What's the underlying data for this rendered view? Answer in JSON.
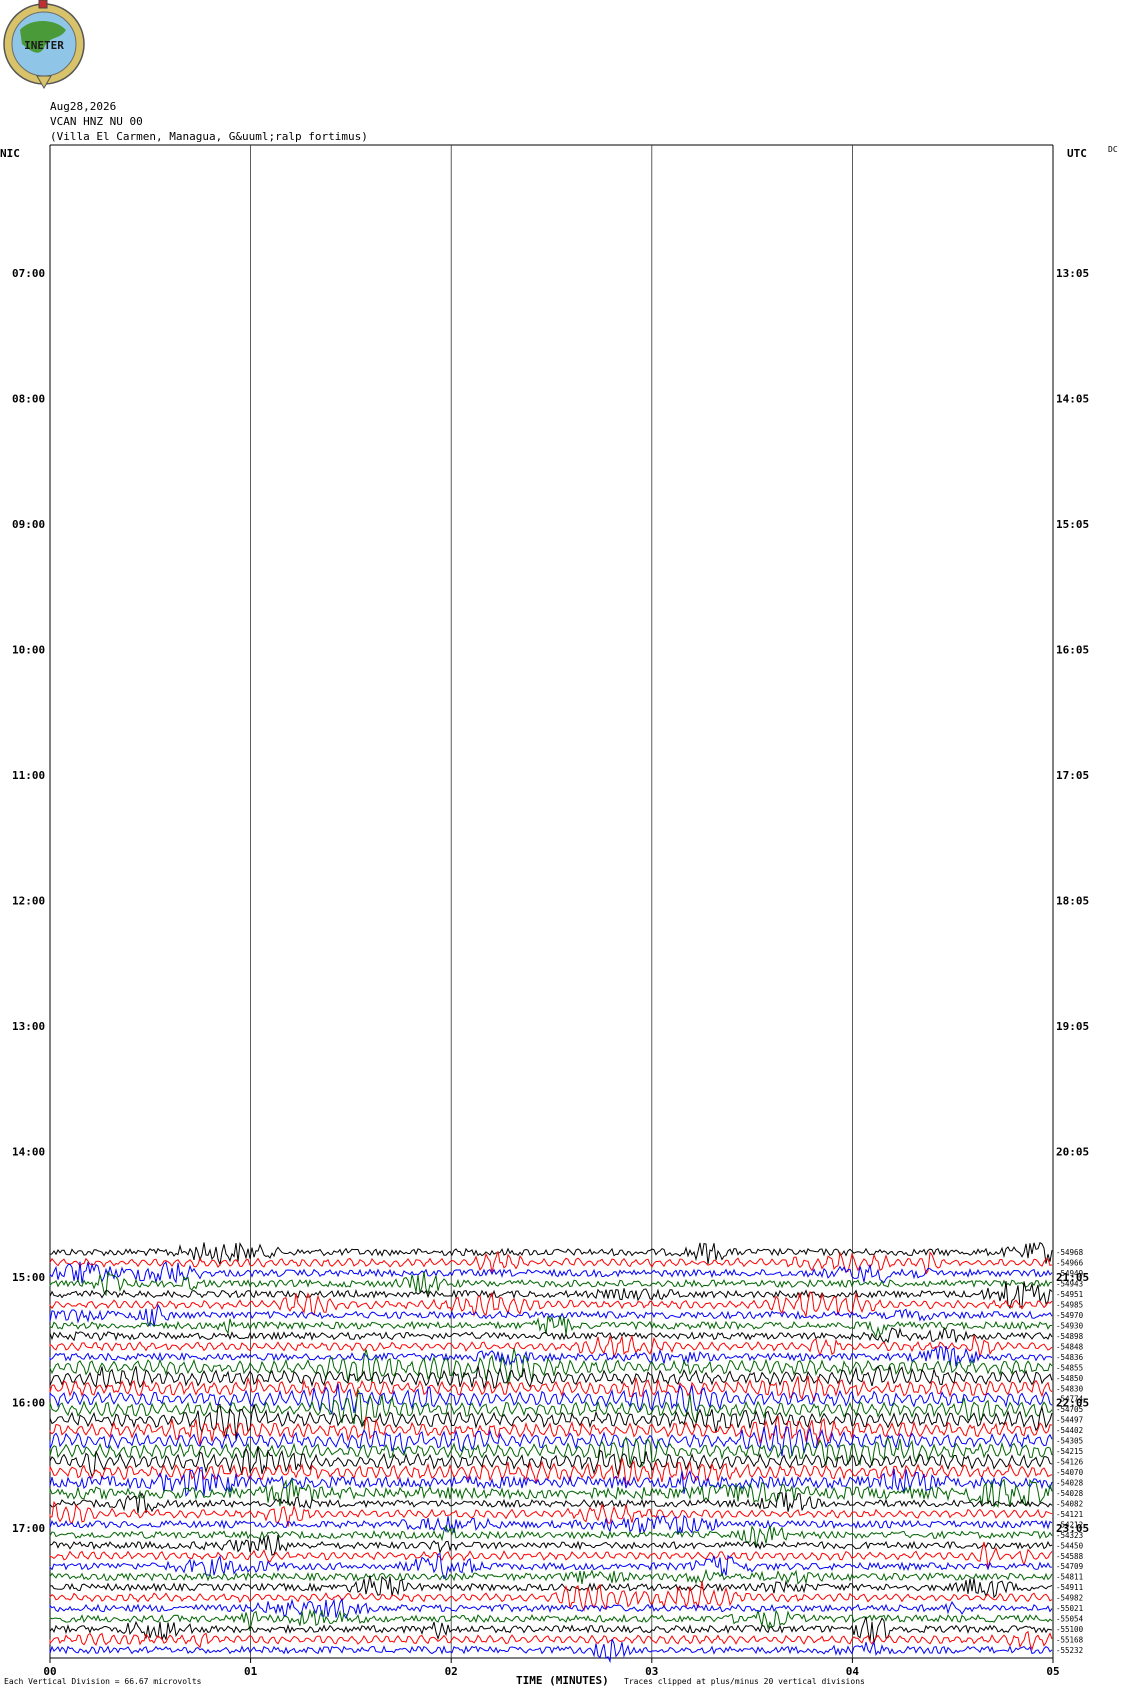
{
  "header": {
    "date": "Aug28,2026",
    "station": "VCAN HNZ NU 00",
    "location": "(Villa El Carmen, Managua, G&uuml;ralp fortimus)",
    "logo_text": "INETER"
  },
  "labels": {
    "left_timezone": "NIC",
    "right_timezone": "UTC",
    "dc": "DC",
    "xlabel": "TIME (MINUTES)",
    "scale_note": "Each Vertical Division =   66.67 microvolts",
    "clip_note": "Traces clipped at plus/minus 20 vertical divisions"
  },
  "chart_data": {
    "type": "line",
    "title": "",
    "xlabel": "TIME (MINUTES)",
    "ylabel": "",
    "xlim": [
      0,
      5
    ],
    "x_ticks": [
      "00",
      "01",
      "02",
      "03",
      "04",
      "05"
    ],
    "y_ticks_left": [
      "07:00",
      "08:00",
      "09:00",
      "10:00",
      "11:00",
      "12:00",
      "13:00",
      "14:00",
      "15:00",
      "16:00",
      "17:00"
    ],
    "y_ticks_right": [
      "13:05",
      "14:05",
      "15:05",
      "16:05",
      "17:05",
      "18:05",
      "19:05",
      "20:05",
      "21:05",
      "22:05",
      "23:05"
    ],
    "vertical_gridlines_minutes": [
      1,
      2,
      3,
      4
    ],
    "trace_colors": [
      "#000000",
      "#ff0000",
      "#0000ff",
      "#006400"
    ],
    "trace_start_time": "14:40",
    "trace_dc_offsets": [
      "-54968",
      "-54966",
      "-54949",
      "-54943",
      "-54951",
      "-54985",
      "-54970",
      "-54930",
      "-54898",
      "-54848",
      "-54836",
      "-54855",
      "-54850",
      "-54830",
      "-54774",
      "-54705",
      "-54497",
      "-54402",
      "-54305",
      "-54215",
      "-54126",
      "-54070",
      "-54028",
      "-54028",
      "-54082",
      "-54121",
      "-54212",
      "-54323",
      "-54450",
      "-54588",
      "-54709",
      "-54811",
      "-54911",
      "-54982",
      "-55021",
      "-55054",
      "-55100",
      "-55168",
      "-55232"
    ]
  }
}
